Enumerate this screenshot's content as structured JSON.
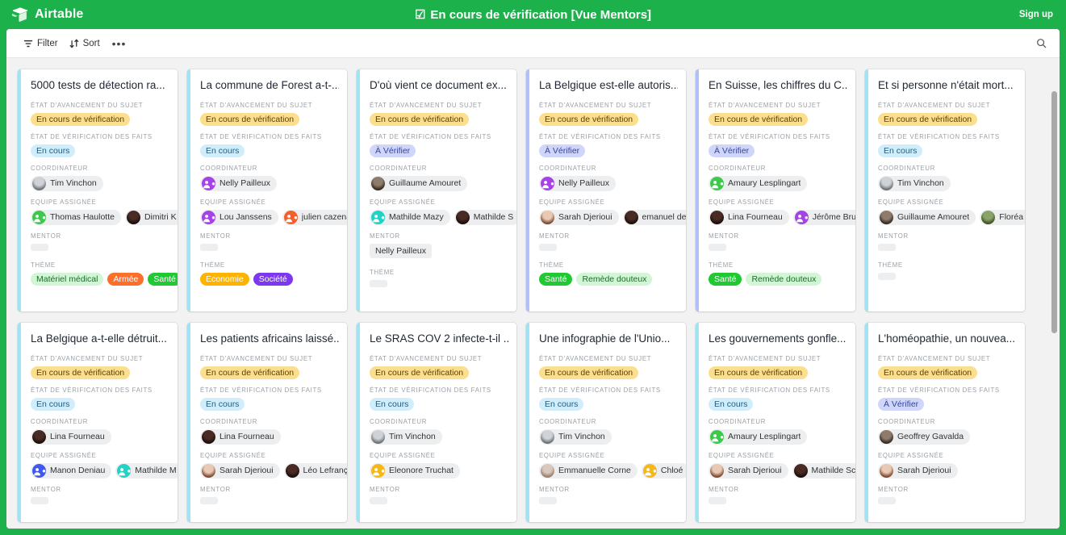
{
  "topbar": {
    "brand": "Airtable",
    "brand_icon": "airtable-logo-icon",
    "title": "En cours de vérification [Vue Mentors]",
    "title_icon": "checked-checkbox-icon",
    "signup_label": "Sign up",
    "bg_color": "#1DB14B"
  },
  "toolbar": {
    "filter_label": "Filter",
    "filter_icon": "filter-icon",
    "sort_label": "Sort",
    "sort_icon": "sort-icon",
    "more_label": "•••",
    "more_icon": "ellipsis-icon",
    "search_icon": "search-icon"
  },
  "field_labels": {
    "etat_avancement": "ÉTAT D'AVANCEMENT DU SUJET",
    "etat_verification": "ÉTAT DE VÉRIFICATION DES FAITS",
    "coordinateur": "COORDINATEUR",
    "equipe": "EQUIPE ASSIGNÉE",
    "mentor": "MENTOR",
    "theme": "THÈME"
  },
  "colors": {
    "status_yellow_bg": "#fcdf8e",
    "status_yellow_text": "#5a4200",
    "encours_bg": "#cfedfb",
    "encours_text": "#1f5e85",
    "averifier_bg": "#d0d6fa",
    "averifier_text": "#33459e",
    "theme_green_bg": "#d2f5d6",
    "theme_green_text": "#1d6b2b",
    "theme_brightgreen_bg": "#20c933",
    "theme_brightgreen_text": "#ffffff",
    "theme_orange_bg": "#ff6f2c",
    "theme_orange_text": "#ffffff",
    "theme_yellow_bg": "#fcb400",
    "theme_yellow_text": "#ffffff",
    "theme_purple_bg": "#7c37ef",
    "theme_purple_text": "#ffffff"
  },
  "cards": [
    {
      "title": "5000 tests de détection ra...",
      "accent": "#9fe3f5",
      "status": "En cours de vérification",
      "verification": "En cours",
      "verification_kind": "encours",
      "coordinateur": {
        "name": "Tim Vinchon",
        "avatar": "photo-gray"
      },
      "equipe": [
        {
          "name": "Thomas Haulotte",
          "avatar": "initial-green"
        },
        {
          "name": "Dimitri K",
          "avatar": "photo-dark"
        }
      ],
      "mentor": "",
      "themes": [
        {
          "label": "Matériel médical",
          "kind": "green-light"
        },
        {
          "label": "Armée",
          "kind": "orange"
        },
        {
          "label": "Santé",
          "kind": "brightgreen"
        }
      ]
    },
    {
      "title": "La commune de Forest a-t-...",
      "accent": "#9fe3f5",
      "status": "En cours de vérification",
      "verification": "En cours",
      "verification_kind": "encours",
      "coordinateur": {
        "name": "Nelly Pailleux",
        "avatar": "initial-purple"
      },
      "equipe": [
        {
          "name": "Lou Janssens",
          "avatar": "initial-purple"
        },
        {
          "name": "julien cazena",
          "avatar": "initial-orange"
        }
      ],
      "mentor": "",
      "themes": [
        {
          "label": "Economie",
          "kind": "yellow"
        },
        {
          "label": "Société",
          "kind": "purple"
        }
      ]
    },
    {
      "title": "D'où vient ce document ex...",
      "accent": "#9fe3f5",
      "status": "En cours de vérification",
      "verification": "À Vérifier",
      "verification_kind": "averifier",
      "coordinateur": {
        "name": "Guillaume Amouret",
        "avatar": "photo-beard"
      },
      "equipe": [
        {
          "name": "Mathilde Mazy",
          "avatar": "initial-teal"
        },
        {
          "name": "Mathilde S",
          "avatar": "photo-dark"
        }
      ],
      "mentor": "Nelly Pailleux",
      "themes": []
    },
    {
      "title": "La Belgique est-elle autoris...",
      "accent": "#b2c0fa",
      "status": "En cours de vérification",
      "verification": "À Vérifier",
      "verification_kind": "averifier",
      "coordinateur": {
        "name": "Nelly Pailleux",
        "avatar": "initial-purple"
      },
      "equipe": [
        {
          "name": "Sarah Djerioui",
          "avatar": "photo-woman"
        },
        {
          "name": "emanuel de",
          "avatar": "photo-dark"
        }
      ],
      "mentor": "",
      "themes": [
        {
          "label": "Santé",
          "kind": "brightgreen"
        },
        {
          "label": "Remède douteux",
          "kind": "green-light"
        }
      ]
    },
    {
      "title": "En Suisse, les chiffres du C...",
      "accent": "#b2c0fa",
      "status": "En cours de vérification",
      "verification": "À Vérifier",
      "verification_kind": "averifier",
      "coordinateur": {
        "name": "Amaury Lesplingart",
        "avatar": "initial-green"
      },
      "equipe": [
        {
          "name": "Lina Fourneau",
          "avatar": "photo-dark"
        },
        {
          "name": "Jérôme Bru",
          "avatar": "initial-purple"
        }
      ],
      "mentor": "",
      "themes": [
        {
          "label": "Santé",
          "kind": "brightgreen"
        },
        {
          "label": "Remède douteux",
          "kind": "green-light"
        }
      ]
    },
    {
      "title": "Et si personne n'était mort...",
      "accent": "#9fe3f5",
      "status": "En cours de vérification",
      "verification": "En cours",
      "verification_kind": "encours",
      "coordinateur": {
        "name": "Tim Vinchon",
        "avatar": "photo-gray"
      },
      "equipe": [
        {
          "name": "Guillaume Amouret",
          "avatar": "photo-beard"
        },
        {
          "name": "Floréa",
          "avatar": "photo-green"
        }
      ],
      "mentor": "",
      "themes": []
    },
    {
      "title": "La Belgique a-t-elle détruit...",
      "accent": "#9fe3f5",
      "status": "En cours de vérification",
      "verification": "En cours",
      "verification_kind": "encours",
      "coordinateur": {
        "name": "Lina Fourneau",
        "avatar": "photo-dark"
      },
      "equipe": [
        {
          "name": "Manon Deniau",
          "avatar": "initial-blue"
        },
        {
          "name": "Mathilde M",
          "avatar": "initial-teal"
        }
      ],
      "mentor": "",
      "themes": []
    },
    {
      "title": "Les patients africains laissé...",
      "accent": "#9fe3f5",
      "status": "En cours de vérification",
      "verification": "En cours",
      "verification_kind": "encours",
      "coordinateur": {
        "name": "Lina Fourneau",
        "avatar": "photo-dark"
      },
      "equipe": [
        {
          "name": "Sarah Djerioui",
          "avatar": "photo-woman"
        },
        {
          "name": "Léo Lefranç",
          "avatar": "photo-dark"
        }
      ],
      "mentor": "",
      "themes": []
    },
    {
      "title": "Le SRAS COV 2 infecte-t-il ...",
      "accent": "#9fe3f5",
      "status": "En cours de vérification",
      "verification": "En cours",
      "verification_kind": "encours",
      "coordinateur": {
        "name": "Tim Vinchon",
        "avatar": "photo-gray"
      },
      "equipe": [
        {
          "name": "Eleonore Truchat",
          "avatar": "initial-yellow"
        }
      ],
      "mentor": "",
      "themes": []
    },
    {
      "title": "Une infographie de l'Unio...",
      "accent": "#9fe3f5",
      "status": "En cours de vérification",
      "verification": "En cours",
      "verification_kind": "encours",
      "coordinateur": {
        "name": "Tim Vinchon",
        "avatar": "photo-gray"
      },
      "equipe": [
        {
          "name": "Emmanuelle Corne",
          "avatar": "photo-light"
        },
        {
          "name": "Chloé",
          "avatar": "initial-yellow"
        }
      ],
      "mentor": "",
      "themes": []
    },
    {
      "title": "Les gouvernements gonfle...",
      "accent": "#9fe3f5",
      "status": "En cours de vérification",
      "verification": "En cours",
      "verification_kind": "encours",
      "coordinateur": {
        "name": "Amaury Lesplingart",
        "avatar": "initial-green"
      },
      "equipe": [
        {
          "name": "Sarah Djerioui",
          "avatar": "photo-woman"
        },
        {
          "name": "Mathilde Sc",
          "avatar": "photo-dark"
        }
      ],
      "mentor": "",
      "themes": []
    },
    {
      "title": "L'homéopathie, un nouvea...",
      "accent": "#9fe3f5",
      "status": "En cours de vérification",
      "verification": "À Vérifier",
      "verification_kind": "averifier",
      "coordinateur": {
        "name": "Geoffrey Gavalda",
        "avatar": "photo-beard"
      },
      "equipe": [
        {
          "name": "Sarah Djerioui",
          "avatar": "photo-woman"
        }
      ],
      "mentor": "",
      "themes": []
    }
  ]
}
